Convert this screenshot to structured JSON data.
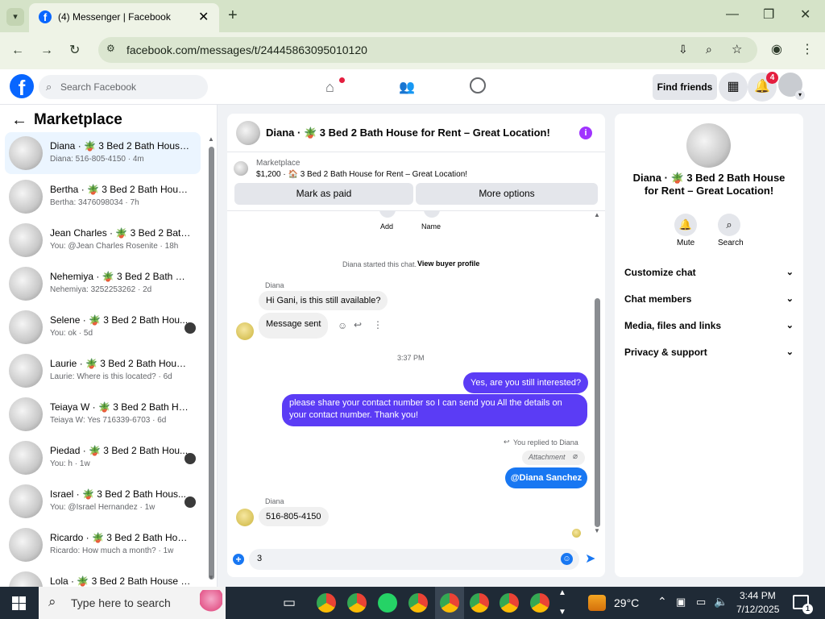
{
  "browser": {
    "tab_title": "(4) Messenger | Facebook",
    "url": "facebook.com/messages/t/24445863095010120"
  },
  "fb_nav": {
    "logo": "f",
    "search_placeholder": "Search Facebook",
    "find_friends": "Find friends",
    "notification_count": "4"
  },
  "left_panel": {
    "title": "Marketplace",
    "conversations": [
      {
        "name": "Diana · 🪴 3 Bed 2 Bath House ...",
        "preview": "Diana: 516-805-4150 · 4m"
      },
      {
        "name": "Bertha · 🪴 3 Bed 2 Bath House...",
        "preview": "Bertha: 3476098034 · 7h"
      },
      {
        "name": "Jean Charles · 🪴 3 Bed 2 Bath ...",
        "preview": "You: @Jean Charles Rosenite · 18h"
      },
      {
        "name": "Nehemiya · 🪴 3 Bed 2 Bath Hou...",
        "preview": "Nehemiya: 3252253262 · 2d"
      },
      {
        "name": "Selene · 🪴 3 Bed 2 Bath Hou...",
        "preview": "You: ok · 5d"
      },
      {
        "name": "Laurie · 🪴 3 Bed 2 Bath House ...",
        "preview": "Laurie: Where is this located? · 6d"
      },
      {
        "name": "Teiaya W · 🪴 3 Bed 2 Bath Hou...",
        "preview": "Teiaya W: Yes 716339-6703 · 6d"
      },
      {
        "name": "Piedad · 🪴 3 Bed 2 Bath Hou...",
        "preview": "You: h · 1w"
      },
      {
        "name": "Israel · 🪴 3 Bed 2 Bath Hous...",
        "preview": "You: @Israel Hernandez · 1w"
      },
      {
        "name": "Ricardo · 🪴 3 Bed 2 Bath Hous...",
        "preview": "Ricardo: How much a month? · 1w"
      },
      {
        "name": "Lola · 🪴 3 Bed 2 Bath House fo...",
        "preview": ""
      }
    ]
  },
  "chat": {
    "header_title": "Diana · 🪴 3 Bed 2 Bath House for Rent – Great Location!",
    "marketplace_label": "Marketplace",
    "listing_line": "$1,200 · 🏠 3 Bed 2 Bath House for Rent – Great Location!",
    "mark_as_paid": "Mark as paid",
    "more_options": "More options",
    "add_label": "Add",
    "name_label": "Name",
    "started_text": "Diana started this chat.",
    "view_buyer_profile": "View buyer profile",
    "sender_name": "Diana",
    "msg_in_1": "Hi Gani, is this still available?",
    "msg_in_2": "Message sent",
    "timestamp": "3:37 PM",
    "msg_out_1": "Yes, are you still interested?",
    "msg_out_2a": "please share your contact number so I can send you All the details on",
    "msg_out_2b": "your contact number. Thank you!",
    "replied_to": "You replied to Diana",
    "attachment": "Attachment",
    "mention": "@Diana Sanchez",
    "sender_name_2": "Diana",
    "msg_in_3": "516-805-4150",
    "composer_value": "3"
  },
  "right_panel": {
    "title_line1": "Diana · 🪴 3 Bed 2 Bath House",
    "title_line2": "for Rent – Great Location!",
    "mute": "Mute",
    "search": "Search",
    "sections": [
      "Customize chat",
      "Chat members",
      "Media, files and links",
      "Privacy & support"
    ]
  },
  "taskbar": {
    "search_placeholder": "Type here to search",
    "temperature": "29°C",
    "time": "3:44 PM",
    "date": "7/12/2025",
    "notif_count": "1"
  },
  "colors": {
    "fb_blue": "#0866ff",
    "outgoing_bubble": "#5b3cf5",
    "mention_bubble": "#1877f2",
    "info_icon": "#a033ff"
  }
}
